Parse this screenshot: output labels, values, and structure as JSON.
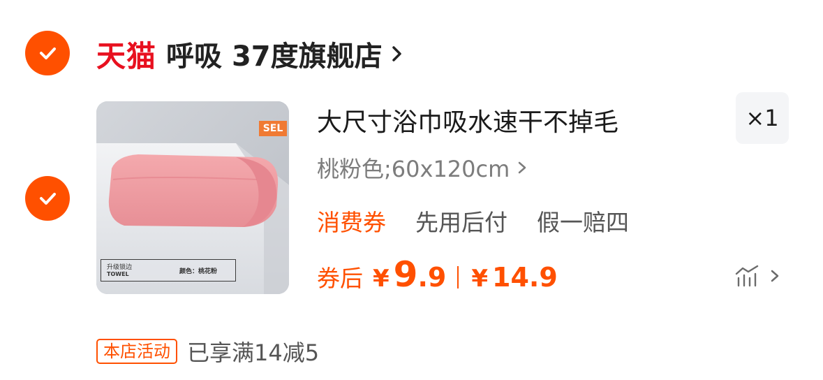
{
  "shop": {
    "platform_logo": "天猫",
    "name": "呼吸 37度旗舰店",
    "selected": true
  },
  "item": {
    "selected": true,
    "image": {
      "badge": "SEL",
      "label_line1": "升级锁边",
      "label_line2": "TOWEL",
      "label_color": "颜色：桃花粉"
    },
    "title": "大尺寸浴巾吸水速干不掉毛",
    "quantity": "×1",
    "sku": "桃粉色;60x120cm",
    "tags": {
      "coupon": "消费券",
      "pay_later": "先用后付",
      "guarantee": "假一赔四"
    },
    "price": {
      "after_coupon_label": "券后",
      "currency": "¥",
      "after_coupon_int": "9",
      "after_coupon_dec": ".9",
      "original_currency": "¥",
      "original": "14.9"
    }
  },
  "promo": {
    "badge": "本店活动",
    "text": "已享满14减5"
  },
  "colors": {
    "accent": "#ff5000",
    "tmall_red": "#e8101f"
  },
  "icons": {
    "check": "check-icon",
    "chevron": "chevron-right-icon",
    "price_trend": "price-trend-icon"
  }
}
